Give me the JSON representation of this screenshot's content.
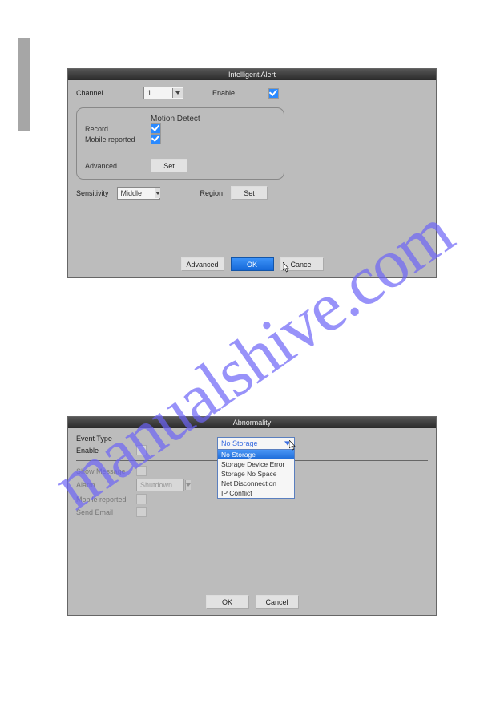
{
  "watermark": "manualshive.com",
  "intelligent_alert": {
    "title": "Intelligent Alert",
    "channel_label": "Channel",
    "channel_value": "1",
    "enable_label": "Enable",
    "group": {
      "motion_detect": "Motion Detect",
      "record_label": "Record",
      "mobile_reported_label": "Mobile reported",
      "advanced_label": "Advanced",
      "set_label": "Set"
    },
    "sensitivity_label": "Sensitivity",
    "sensitivity_value": "Middle",
    "region_label": "Region",
    "region_set_label": "Set",
    "footer": {
      "advanced": "Advanced",
      "ok": "OK",
      "cancel": "Cancel"
    }
  },
  "abnormality": {
    "title": "Abnormality",
    "event_type_label": "Event Type",
    "enable_label": "Enable",
    "show_message_label": "Show Message",
    "alarm_label": "Alarm",
    "alarm_value": "Shutdown",
    "mobile_reported_label": "Mobile reported",
    "send_email_label": "Send Email",
    "event_type_selected": "No Storage",
    "event_type_options": [
      "No Storage",
      "Storage Device Error",
      "Storage No Space",
      "Net Disconnection",
      "IP Conflict"
    ],
    "footer": {
      "ok": "OK",
      "cancel": "Cancel"
    }
  }
}
